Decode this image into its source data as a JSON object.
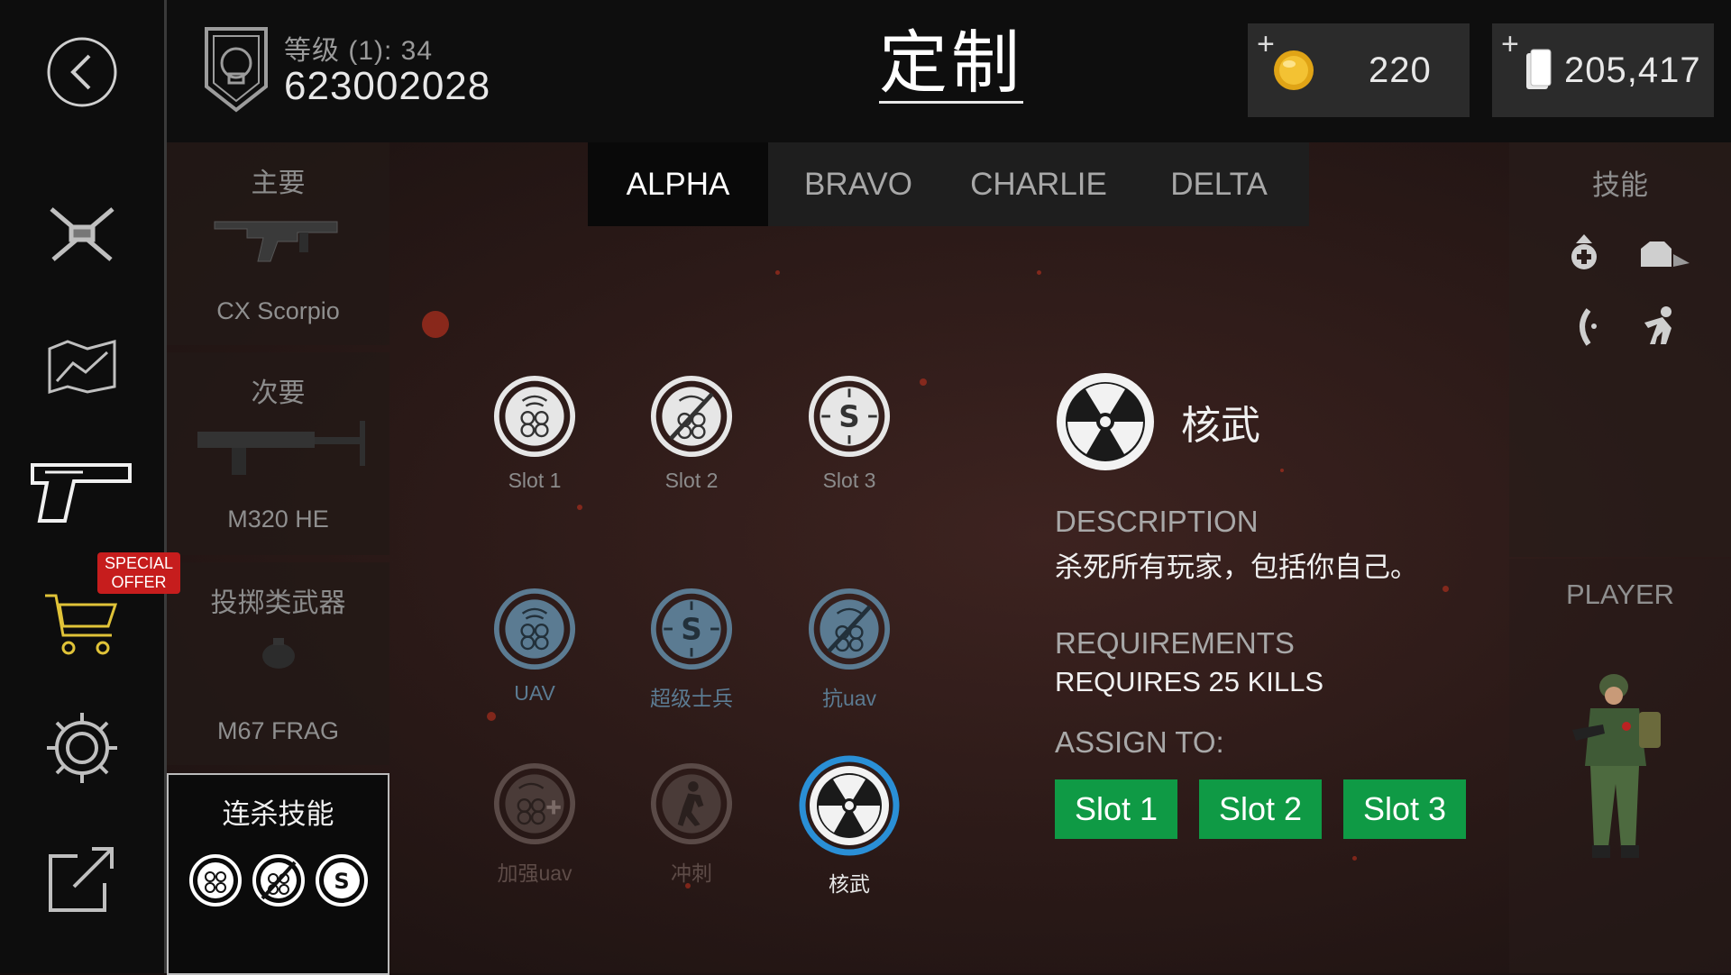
{
  "header": {
    "level_label": "等级 (1): 34",
    "player_id": "623002028",
    "page_title": "定制",
    "coins": {
      "plus": "+",
      "amount": "220"
    },
    "cards": {
      "plus": "+",
      "amount": "205,417"
    }
  },
  "left_rail": {
    "items": [
      {
        "icon": "back-arrow-icon"
      },
      {
        "icon": "crossed-weapons-icon"
      },
      {
        "icon": "map-icon"
      },
      {
        "icon": "pistol-icon"
      },
      {
        "icon": "shopping-cart-icon"
      },
      {
        "icon": "gear-icon"
      },
      {
        "icon": "external-link-icon"
      }
    ],
    "special_offer": "SPECIAL OFFER"
  },
  "loadout": {
    "primary": {
      "category": "主要",
      "weapon": "CX Scorpio"
    },
    "secondary": {
      "category": "次要",
      "weapon": "M320 HE"
    },
    "throwable": {
      "category": "投掷类武器",
      "weapon": "M67 FRAG"
    },
    "killstreak": {
      "category": "连杀技能",
      "icons": [
        "uav-icon",
        "anti-uav-icon",
        "super-soldier-icon"
      ]
    }
  },
  "tabs": [
    {
      "label": "ALPHA",
      "active": true
    },
    {
      "label": "BRAVO",
      "active": false
    },
    {
      "label": "CHARLIE",
      "active": false
    },
    {
      "label": "DELTA",
      "active": false
    }
  ],
  "perks": {
    "row1": [
      {
        "label": "Slot 1",
        "icon": "uav-icon"
      },
      {
        "label": "Slot 2",
        "icon": "anti-uav-icon"
      },
      {
        "label": "Slot 3",
        "icon": "super-soldier-icon"
      }
    ],
    "row2": [
      {
        "label": "UAV",
        "icon": "uav-icon"
      },
      {
        "label": "超级士兵",
        "icon": "super-soldier-icon"
      },
      {
        "label": "抗uav",
        "icon": "anti-uav-icon"
      }
    ],
    "row3": [
      {
        "label": "加强uav",
        "icon": "advanced-uav-icon"
      },
      {
        "label": "冲刺",
        "icon": "sprint-icon"
      },
      {
        "label": "核武",
        "icon": "nuke-icon",
        "selected": true
      }
    ]
  },
  "detail": {
    "name": "核武",
    "description_heading": "DESCRIPTION",
    "description": "杀死所有玩家，包括你自己。",
    "requirements_heading": "REQUIREMENTS",
    "requirements": "REQUIRES 25 KILLS",
    "assign_heading": "ASSIGN TO:",
    "assign_buttons": [
      "Slot 1",
      "Slot 2",
      "Slot 3"
    ]
  },
  "right_col": {
    "skills_title": "技能",
    "player_title": "PLAYER"
  },
  "colors": {
    "assign_green": "#0f9a45",
    "selected_ring": "#2a8fd6",
    "locked_blue": "#5b7b92",
    "special_offer_red": "#c61d1d"
  }
}
